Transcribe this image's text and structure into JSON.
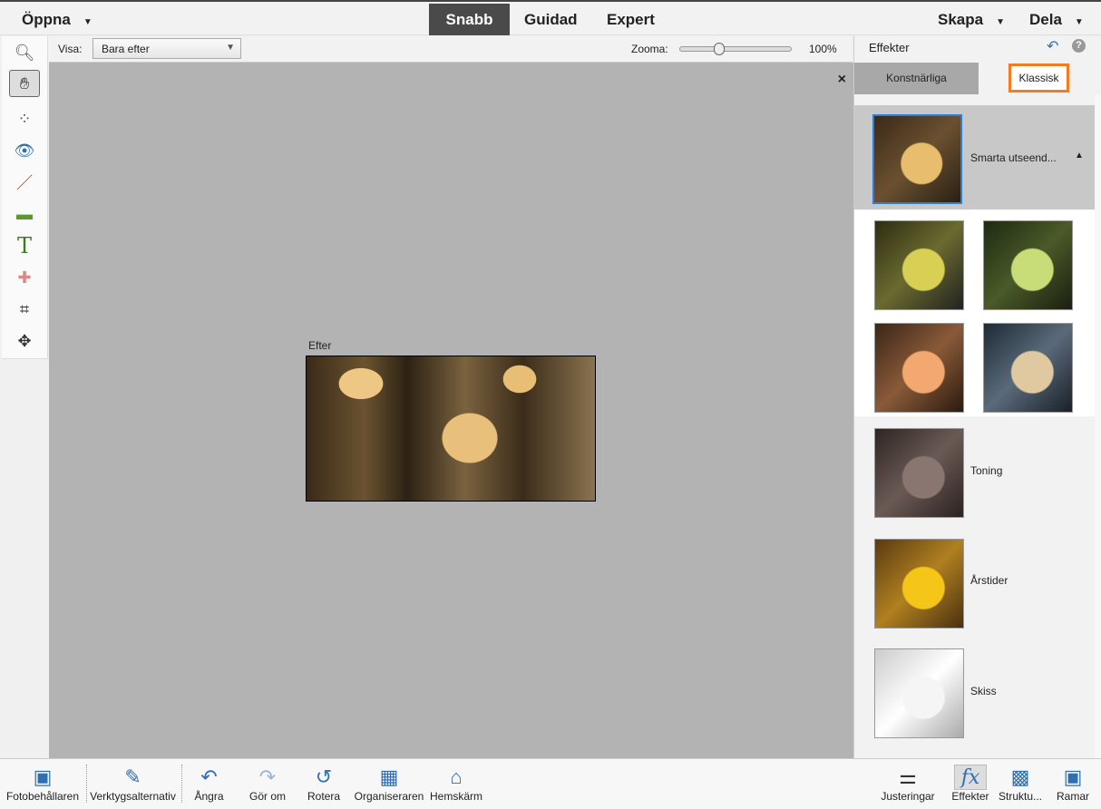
{
  "top": {
    "open": "Öppna",
    "modes": [
      "Snabb",
      "Guidad",
      "Expert"
    ],
    "create": "Skapa",
    "share": "Dela"
  },
  "options": {
    "view_label": "Visa:",
    "view_value": "Bara efter",
    "zoom_label": "Zooma:",
    "zoom_value": "100%",
    "zoom_fraction": 0.33
  },
  "canvas": {
    "image_label": "Efter",
    "close": "×"
  },
  "panel": {
    "title": "Effekter",
    "tabs": [
      "Konstnärliga",
      "Klassisk"
    ],
    "active_tab": "Klassisk",
    "accent": "#f47b20",
    "items": [
      "Smarta utseend...",
      "Toning",
      "Årstider",
      "Skiss"
    ]
  },
  "bottom": {
    "left": [
      "Fotobehållaren",
      "Verktygsalternativ",
      "Ångra",
      "Gör om",
      "Rotera",
      "Organiseraren",
      "Hemskärm"
    ],
    "right": [
      "Justeringar",
      "Effekter",
      "Struktu...",
      "Ramar"
    ]
  }
}
